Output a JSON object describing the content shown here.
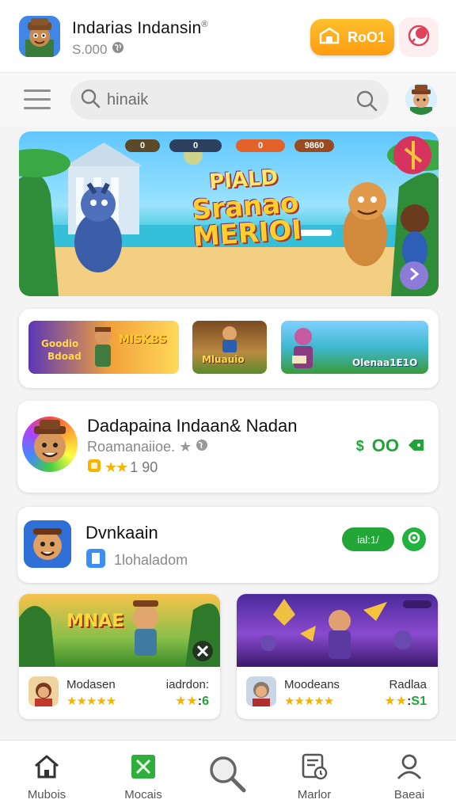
{
  "header": {
    "app_title": "Indarias Indansin",
    "app_title_mark": "®",
    "app_subtitle": "S.000",
    "coin_button_label": "RoO1"
  },
  "search": {
    "placeholder": "hinaik"
  },
  "banner": {
    "title_line1": "PIALD",
    "title_line2": "Sranao",
    "title_line3": "MERIOI",
    "stat_values": [
      "0",
      "0",
      "0",
      "9860"
    ]
  },
  "promos": [
    {
      "label_top": "Goodio",
      "label_bottom": "Bdoad",
      "label_right": "MISKBS"
    },
    {
      "label": "Mluauio"
    },
    {
      "label": "Olenaa1E1O"
    }
  ],
  "featured": {
    "title": "Dadapaina Indaan& Nadan",
    "subtitle": "Roamanaiioe.",
    "rating": "1 90",
    "price_symbol": "$",
    "price": "OO"
  },
  "download_card": {
    "title": "Dvnkaain",
    "subtitle": "1lohaladom",
    "button_label": "ial:1/"
  },
  "games": [
    {
      "art_title": "MNAE",
      "name": "Modasen",
      "right_label": "iadrdon:",
      "score": "6",
      "score_prefix": "★★"
    },
    {
      "art_title": "",
      "name": "Moodeans",
      "right_label": "Radlaa",
      "score": "S1",
      "score_prefix": "★★"
    }
  ],
  "bottom_nav": [
    {
      "label": "Mubois",
      "icon": "home-icon"
    },
    {
      "label": "Mocais",
      "icon": "game-icon"
    },
    {
      "label": "",
      "icon": "search-icon"
    },
    {
      "label": "Marlor",
      "icon": "document-icon"
    },
    {
      "label": "Baeai",
      "icon": "user-icon"
    }
  ],
  "colors": {
    "accent_green": "#22a638",
    "coin_orange": "#ffa618",
    "star_yellow": "#f5b400"
  }
}
